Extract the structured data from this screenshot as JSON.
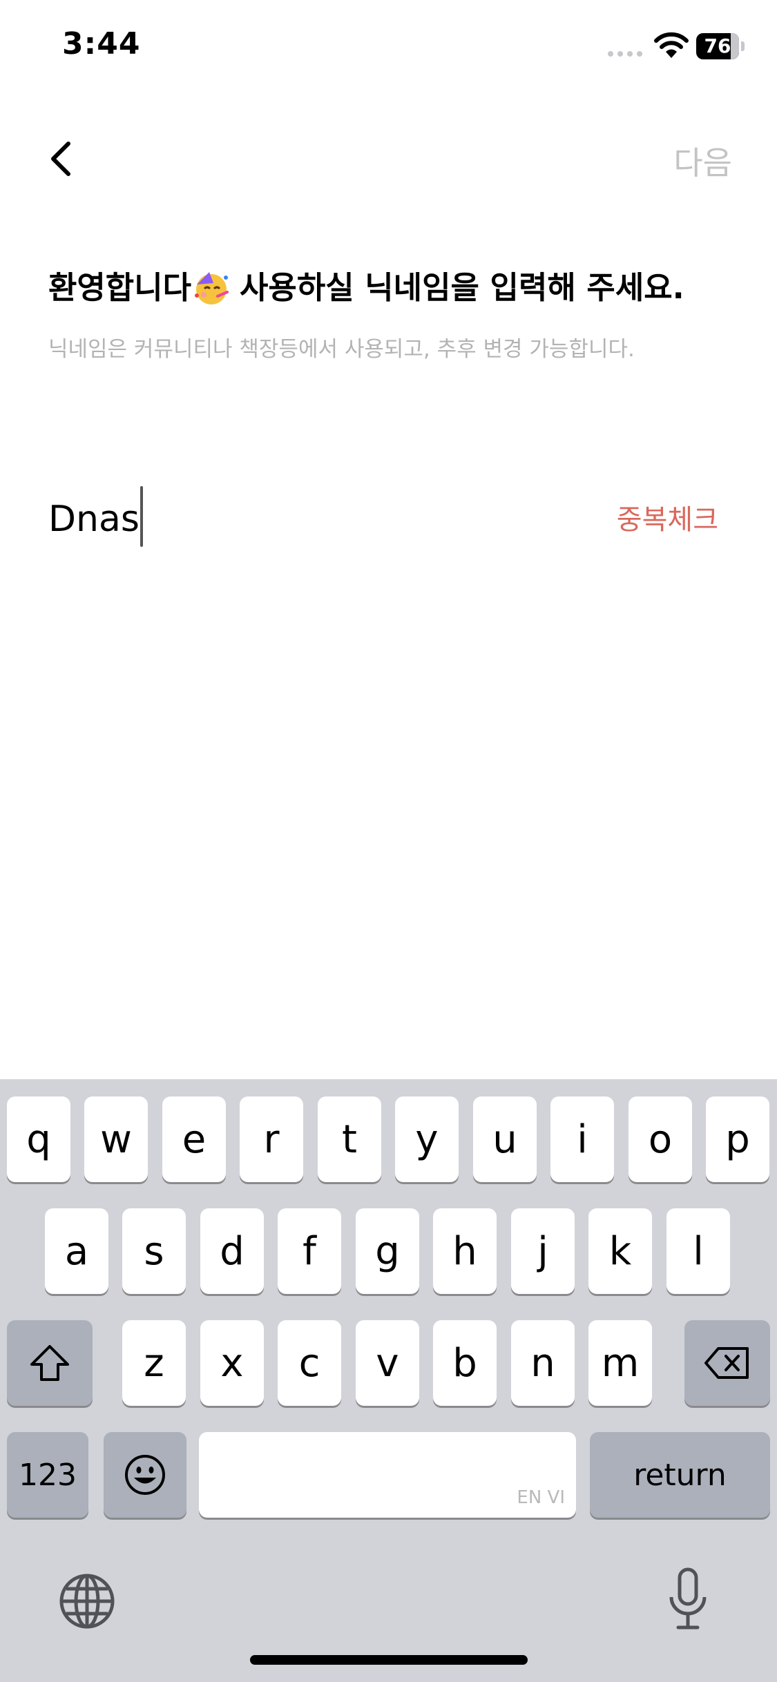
{
  "status_bar": {
    "time": "3:44",
    "battery": "76"
  },
  "nav": {
    "next_label": "다음"
  },
  "content": {
    "title": "환영합니다",
    "title_rest": "사용하실 닉네임을 입력해 주세요.",
    "subtitle": "닉네임은 커뮤니티나 책장등에서 사용되고, 추후 변경 가능합니다.",
    "nickname_value": "Dnas",
    "dup_check_label": "중복체크"
  },
  "keyboard": {
    "row1": [
      "q",
      "w",
      "e",
      "r",
      "t",
      "y",
      "u",
      "i",
      "o",
      "p"
    ],
    "row2": [
      "a",
      "s",
      "d",
      "f",
      "g",
      "h",
      "j",
      "k",
      "l"
    ],
    "row3": [
      "z",
      "x",
      "c",
      "v",
      "b",
      "n",
      "m"
    ],
    "numbers_label": "123",
    "space_tag": "EN VI",
    "return_label": "return"
  },
  "colors": {
    "accent": "#d9685c",
    "disabled": "#c3c3c3",
    "keyboard_bg": "#d1d3d9"
  }
}
